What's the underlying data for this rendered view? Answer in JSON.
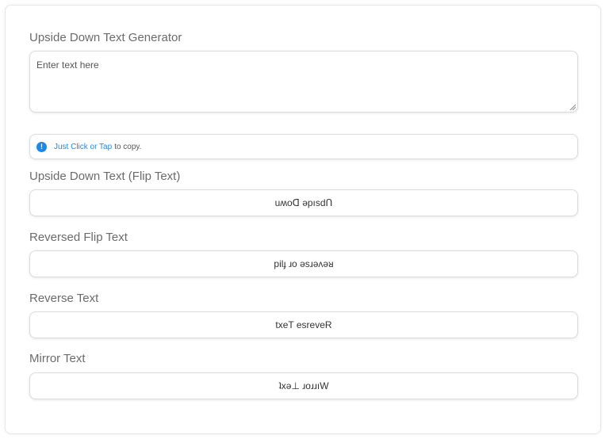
{
  "generator": {
    "title": "Upside Down Text Generator",
    "input_placeholder": "Enter text here",
    "input_value": ""
  },
  "notice": {
    "icon": "exclamation-circle-icon",
    "link_text": "Just Click or Tap",
    "suffix_text": "to copy."
  },
  "outputs": [
    {
      "label": "Upside Down Text (Flip Text)",
      "value": "uʍoᗡ ǝpısdՈ"
    },
    {
      "label": "Reversed Flip Text",
      "value": "pilɟ ɹo ǝsɹǝʌǝᴚ"
    },
    {
      "label": "Reverse Text",
      "value": "txeT esreveR"
    },
    {
      "label": "Mirror Text",
      "value": "ʇxǝ⊥ ɹoɹɹıW"
    }
  ],
  "colors": {
    "label": "#6b6b6b",
    "border": "#dcdcdc",
    "accent": "#1e88e5"
  }
}
